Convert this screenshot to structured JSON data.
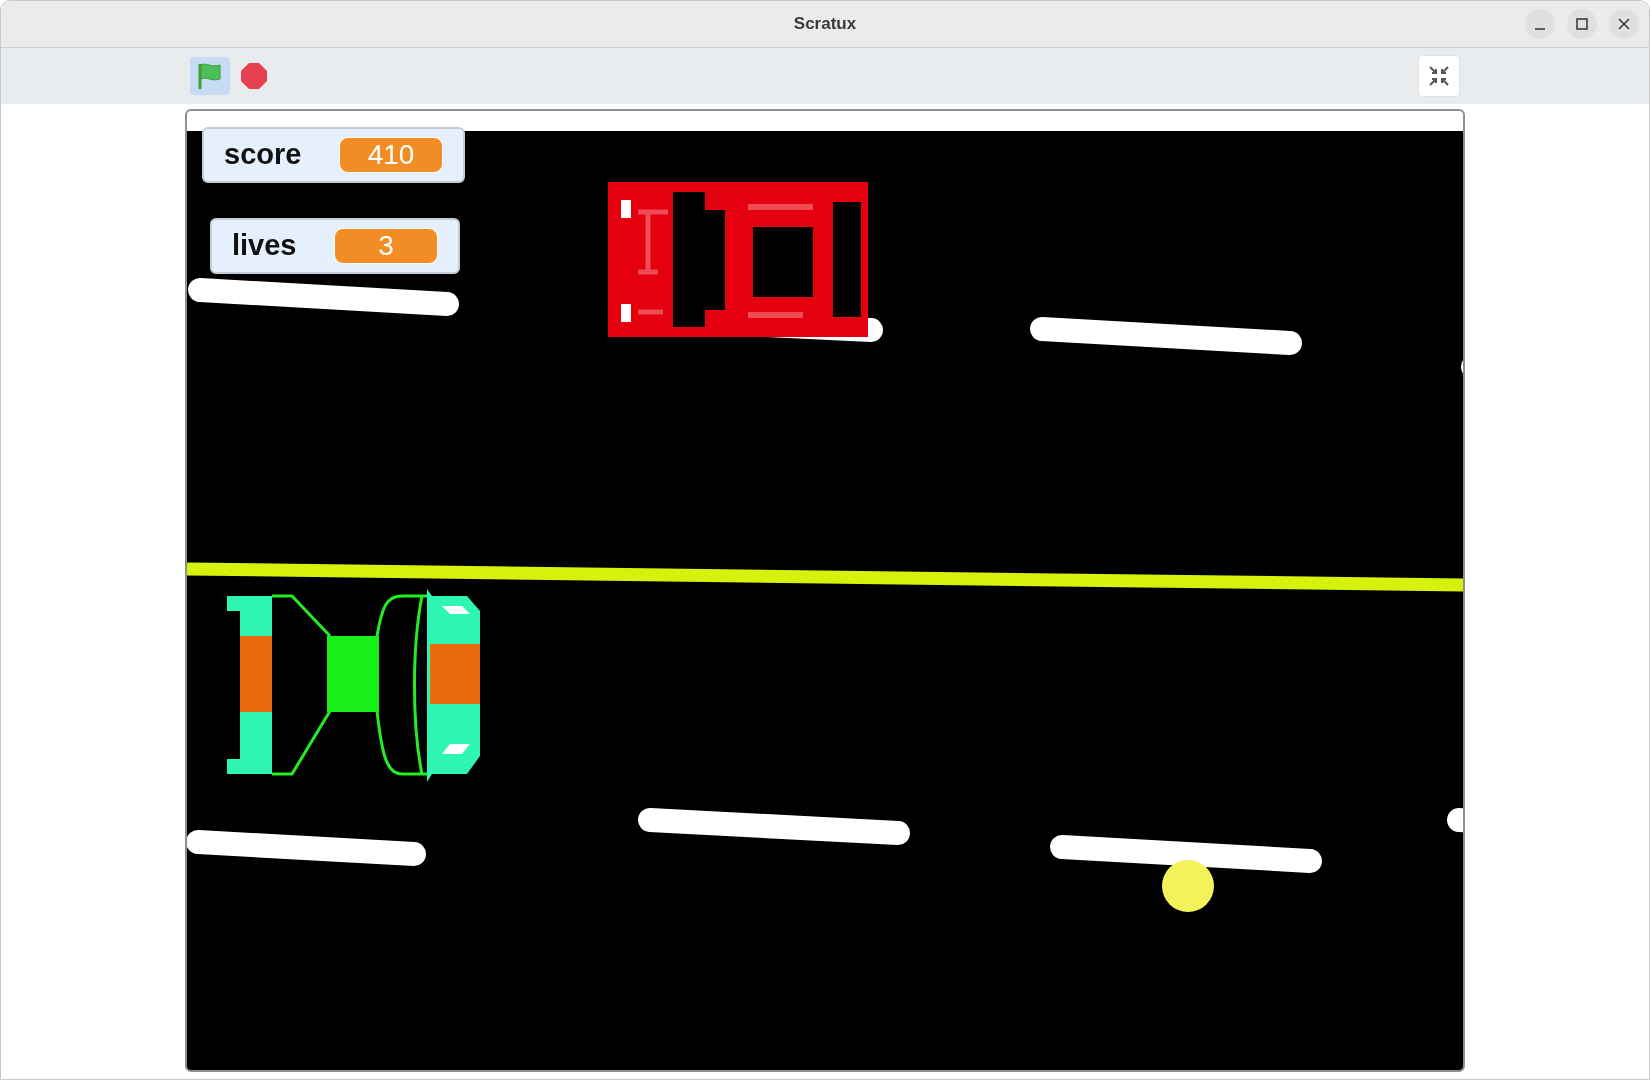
{
  "window": {
    "title": "Scratux"
  },
  "toolbar": {
    "green_flag": {
      "selected": true
    }
  },
  "monitors": [
    {
      "label": "score",
      "value": "410"
    },
    {
      "label": "lives",
      "value": "3"
    }
  ]
}
